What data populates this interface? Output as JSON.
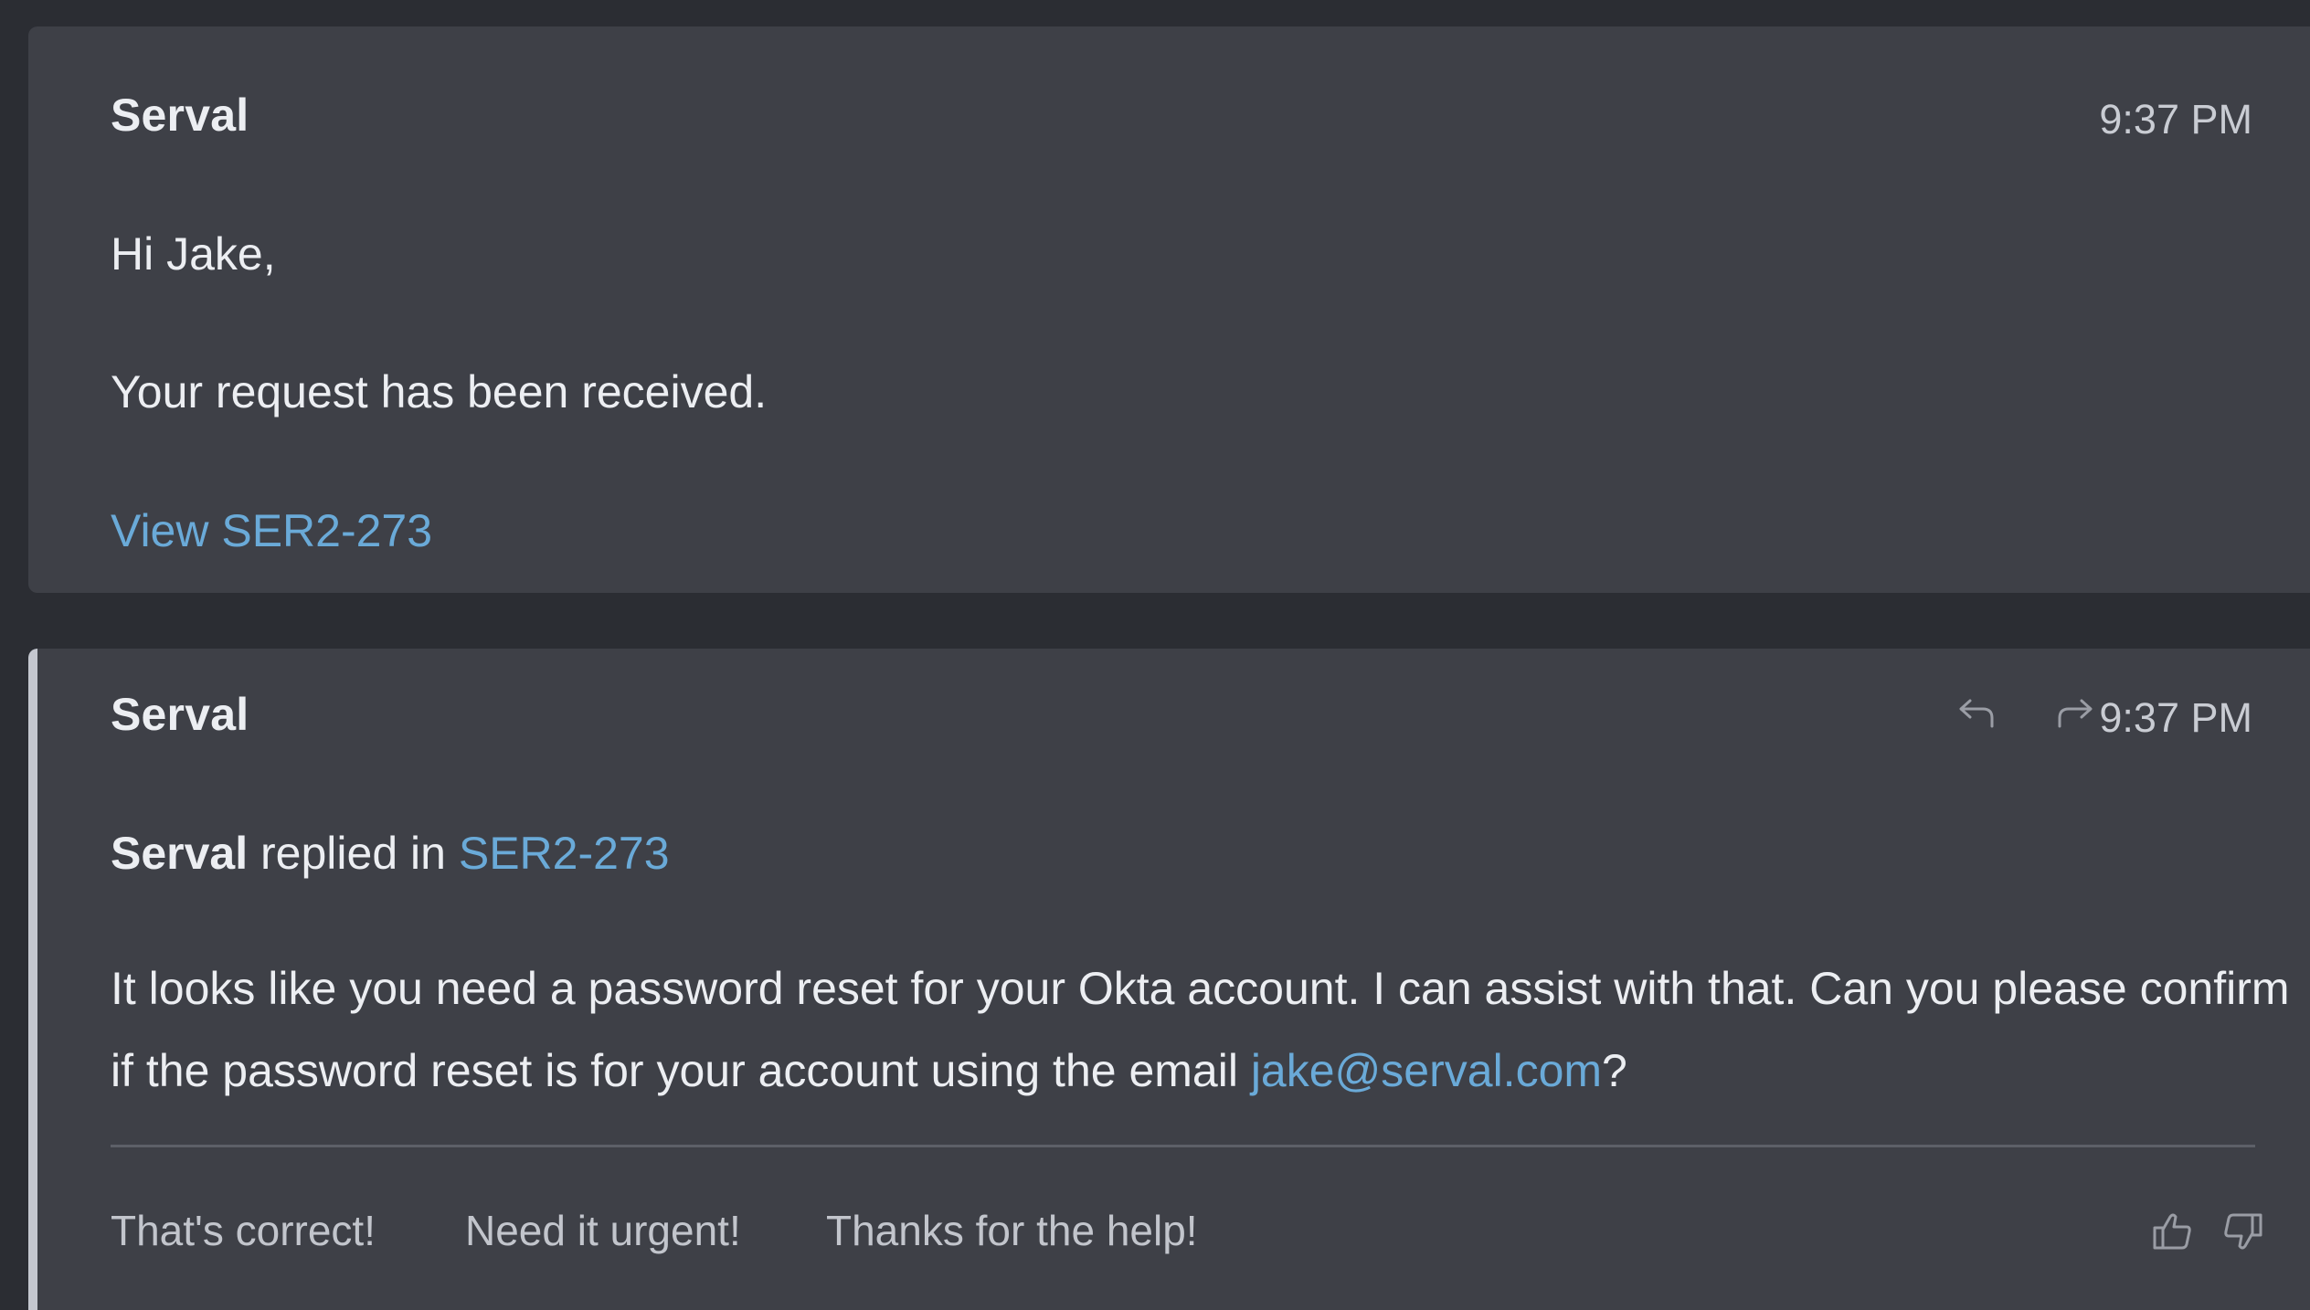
{
  "messages": [
    {
      "sender": "Serval",
      "time": "9:37 PM",
      "greeting": "Hi Jake,",
      "body": "Your request has been received.",
      "link_label": "View SER2-273"
    },
    {
      "sender": "Serval",
      "time": "9:37 PM",
      "reply_author": "Serval",
      "reply_text": "replied in",
      "ticket": "SER2-273",
      "body_text": "It looks like you need a password reset for your Okta account. I can assist with that. Can you please confirm if the password reset is for your account using the email ",
      "email": "jake@serval.com",
      "body_end": "?",
      "quick_replies": [
        "That's correct!",
        "Need it urgent!",
        "Thanks for the help!"
      ]
    }
  ],
  "icons": {
    "reply": "reply-icon",
    "forward": "forward-icon",
    "thumbs_up": "thumbs-up-icon",
    "thumbs_down": "thumbs-down-icon"
  },
  "colors": {
    "background": "#2b2d33",
    "card": "#3e4047",
    "link": "#6aaad8",
    "accent_bar": "#c4c7cf"
  }
}
